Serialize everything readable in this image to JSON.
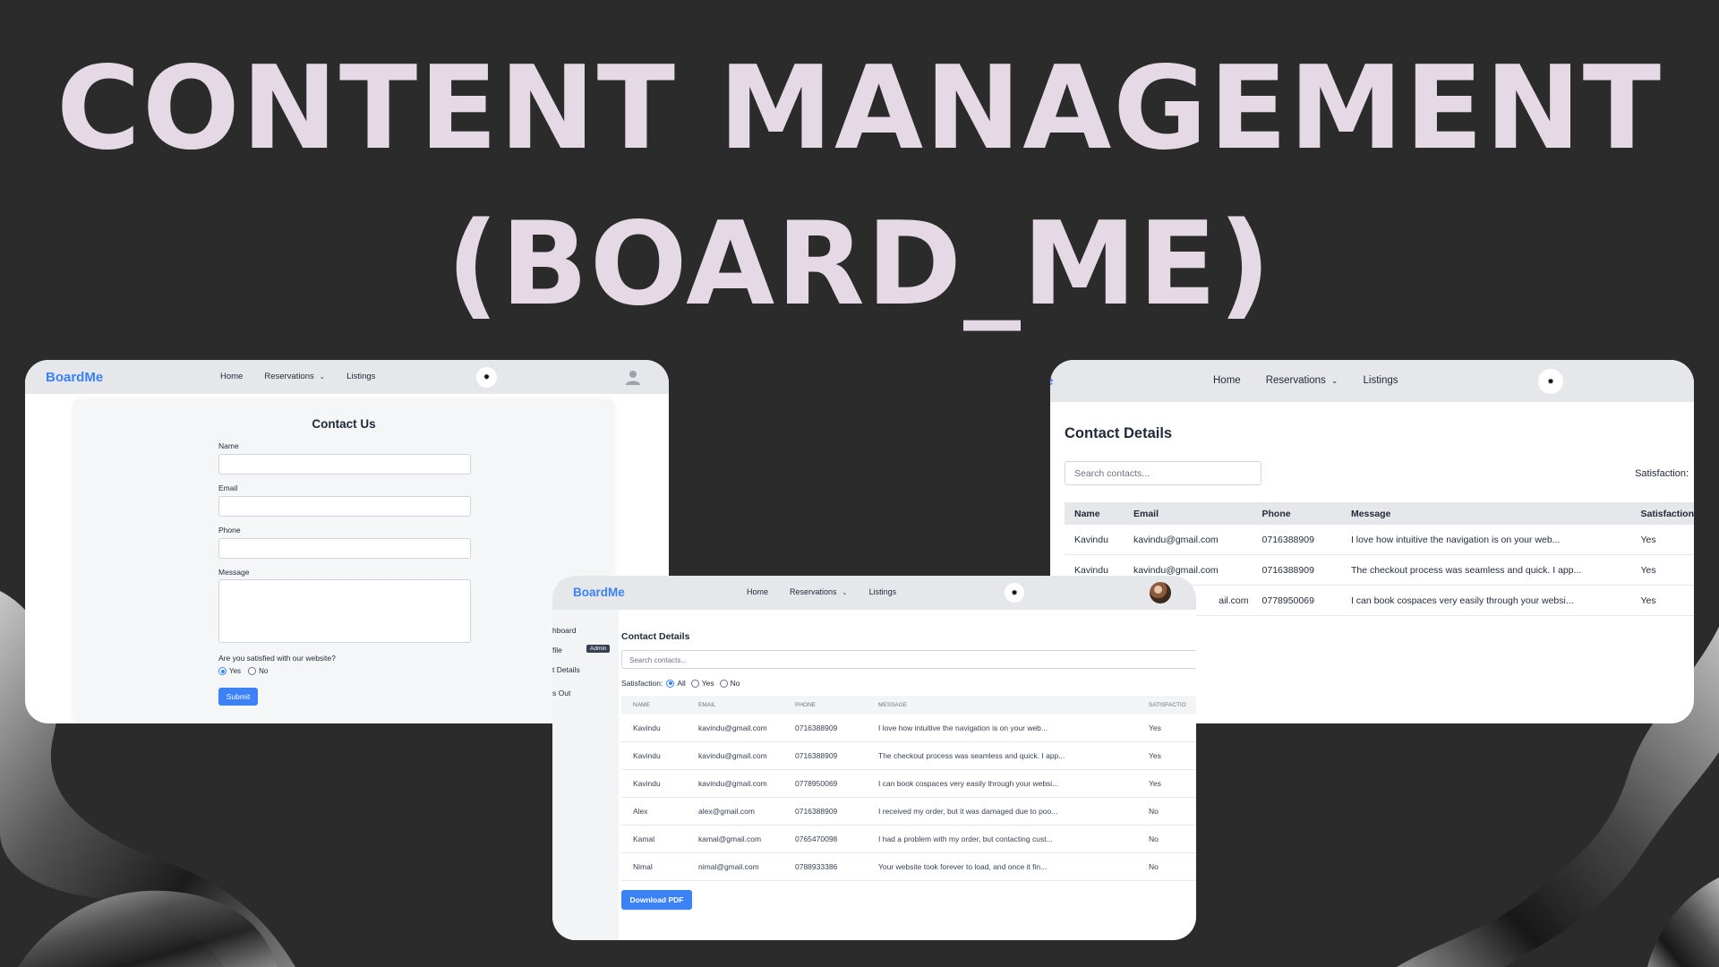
{
  "hero": {
    "line1": "CONTENT MANAGEMENT",
    "line2": "(BOARD_ME)"
  },
  "colors": {
    "background": "#2b2b2b",
    "title": "#e4d9e4",
    "brand": "#3b82f6",
    "button": "#3b82f6"
  },
  "icons": {
    "theme_toggle": "sun-icon",
    "profile": "user-icon",
    "dropdown": "chevron-down-icon"
  },
  "contact_form_screen": {
    "brand": "BoardMe",
    "nav": {
      "home": "Home",
      "reservations": "Reservations",
      "listings": "Listings"
    },
    "toggle_glyph": "✹",
    "form": {
      "title": "Contact Us",
      "name_label": "Name",
      "email_label": "Email",
      "phone_label": "Phone",
      "message_label": "Message",
      "question": "Are you satisfied with our website?",
      "options": [
        "Yes",
        "No"
      ],
      "selected": "Yes",
      "submit": "Submit"
    }
  },
  "contact_details_screen": {
    "brand_fragment": "e",
    "nav": {
      "home": "Home",
      "reservations": "Reservations",
      "listings": "Listings"
    },
    "toggle_glyph": "✹",
    "title": "Contact Details",
    "search_placeholder": "Search contacts...",
    "satisfaction_label": "Satisfaction:",
    "columns": [
      "Name",
      "Email",
      "Phone",
      "Message",
      "Satisfaction"
    ],
    "rows": [
      [
        "Kavindu",
        "kavindu@gmail.com",
        "0716388909",
        "I love how intuitive the navigation is on your web...",
        "Yes"
      ],
      [
        "Kavindu",
        "kavindu@gmail.com",
        "0716388909",
        "The checkout process was seamless and quick. I app...",
        "Yes"
      ],
      [
        "",
        "ail.com",
        "0778950069",
        "I can book cospaces very easily through your websi...",
        "Yes"
      ]
    ]
  },
  "admin_screen": {
    "brand": "BoardMe",
    "nav": {
      "home": "Home",
      "reservations": "Reservations",
      "listings": "Listings"
    },
    "toggle_glyph": "✹",
    "sidebar": [
      "hboard",
      "file",
      "t Details",
      "s Out"
    ],
    "admin_badge": "Admin",
    "title": "Contact Details",
    "search_placeholder": "Search contacts...",
    "satisfaction_label": "Satisfaction:",
    "filters": [
      "All",
      "Yes",
      "No"
    ],
    "selected_filter": "All",
    "columns": [
      "NAME",
      "EMAIL",
      "PHONE",
      "MESSAGE",
      "SATISFACTIO"
    ],
    "rows": [
      [
        "Kavindu",
        "kavindu@gmail.com",
        "0716388909",
        "I love how intuitive the navigation is on your web...",
        "Yes"
      ],
      [
        "Kavindu",
        "kavindu@gmail.com",
        "0716388909",
        "The checkout process was seamless and quick. I app...",
        "Yes"
      ],
      [
        "Kavindu",
        "kavindu@gmail.com",
        "0778950069",
        "I can book cospaces very easily through your websi...",
        "Yes"
      ],
      [
        "Alex",
        "alex@gmail.com",
        "0716388909",
        "I received my order, but it was damaged due to poo...",
        "No"
      ],
      [
        "Kamal",
        "kamal@gmail.com",
        "0765470098",
        "I had a problem with my order, but contacting cust...",
        "No"
      ],
      [
        "Nimal",
        "nimal@gmail.com",
        "0788933386",
        "Your website took forever to load, and once it fin...",
        "No"
      ]
    ],
    "download": "Download PDF"
  }
}
